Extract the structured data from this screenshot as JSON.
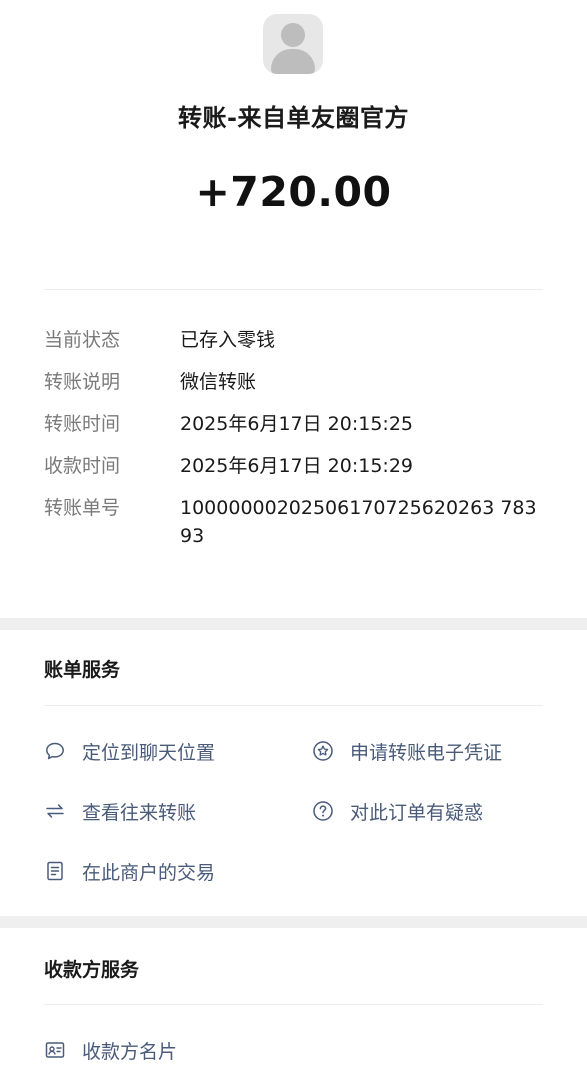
{
  "header": {
    "title": "转账-来自单友圈官方",
    "amount": "+720.00"
  },
  "details": [
    {
      "label": "当前状态",
      "value": "已存入零钱"
    },
    {
      "label": "转账说明",
      "value": "微信转账"
    },
    {
      "label": "转账时间",
      "value": "2025年6月17日 20:15:25"
    },
    {
      "label": "收款时间",
      "value": "2025年6月17日 20:15:29"
    },
    {
      "label": "转账单号",
      "value": "10000000202506170725620263 78393"
    }
  ],
  "bill_services": {
    "title": "账单服务",
    "items": [
      {
        "label": "定位到聊天位置",
        "icon": "chat-bubble-icon"
      },
      {
        "label": "申请转账电子凭证",
        "icon": "certificate-star-icon"
      },
      {
        "label": "查看往来转账",
        "icon": "transfer-arrows-icon"
      },
      {
        "label": "对此订单有疑惑",
        "icon": "question-circle-icon"
      },
      {
        "label": "在此商户的交易",
        "icon": "document-icon"
      }
    ]
  },
  "payee_services": {
    "title": "收款方服务",
    "items": [
      {
        "label": "收款方名片",
        "icon": "business-card-icon"
      }
    ]
  },
  "colors": {
    "link": "#4a5b7a",
    "label": "#7a7a7a",
    "band": "#efefef"
  }
}
